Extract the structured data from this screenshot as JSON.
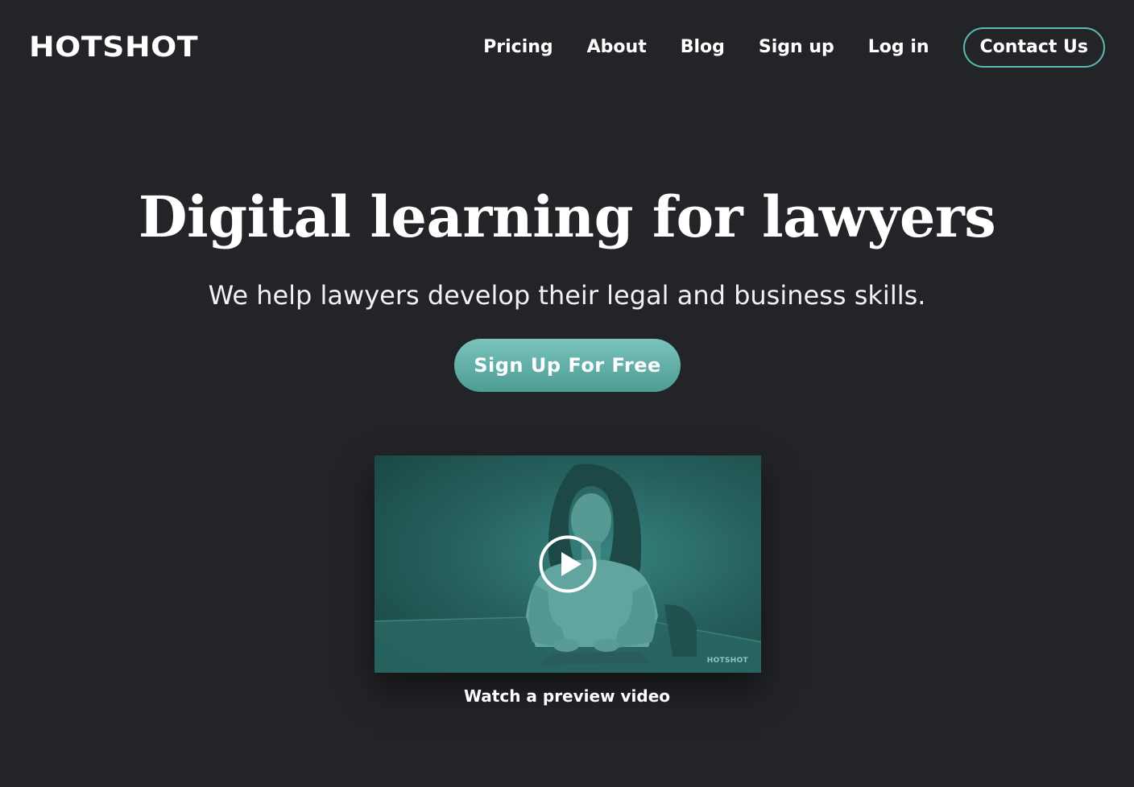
{
  "brand": {
    "logo_text": "HOTSHOT"
  },
  "nav": {
    "items": [
      {
        "label": "Pricing"
      },
      {
        "label": "About"
      },
      {
        "label": "Blog"
      },
      {
        "label": "Sign up"
      },
      {
        "label": "Log in"
      }
    ],
    "contact_label": "Contact Us"
  },
  "hero": {
    "title": "Digital learning for lawyers",
    "subtitle": "We help lawyers develop their legal and business skills.",
    "cta_label": "Sign Up For Free"
  },
  "video": {
    "watermark": "HOTSHOT",
    "play_icon": "play-icon",
    "caption": "Watch a preview video"
  },
  "colors": {
    "background": "#232428",
    "accent": "#5dbbb3",
    "cta_gradient_top": "#79c4bc",
    "cta_gradient_bottom": "#4e9c96",
    "text": "#ffffff"
  }
}
